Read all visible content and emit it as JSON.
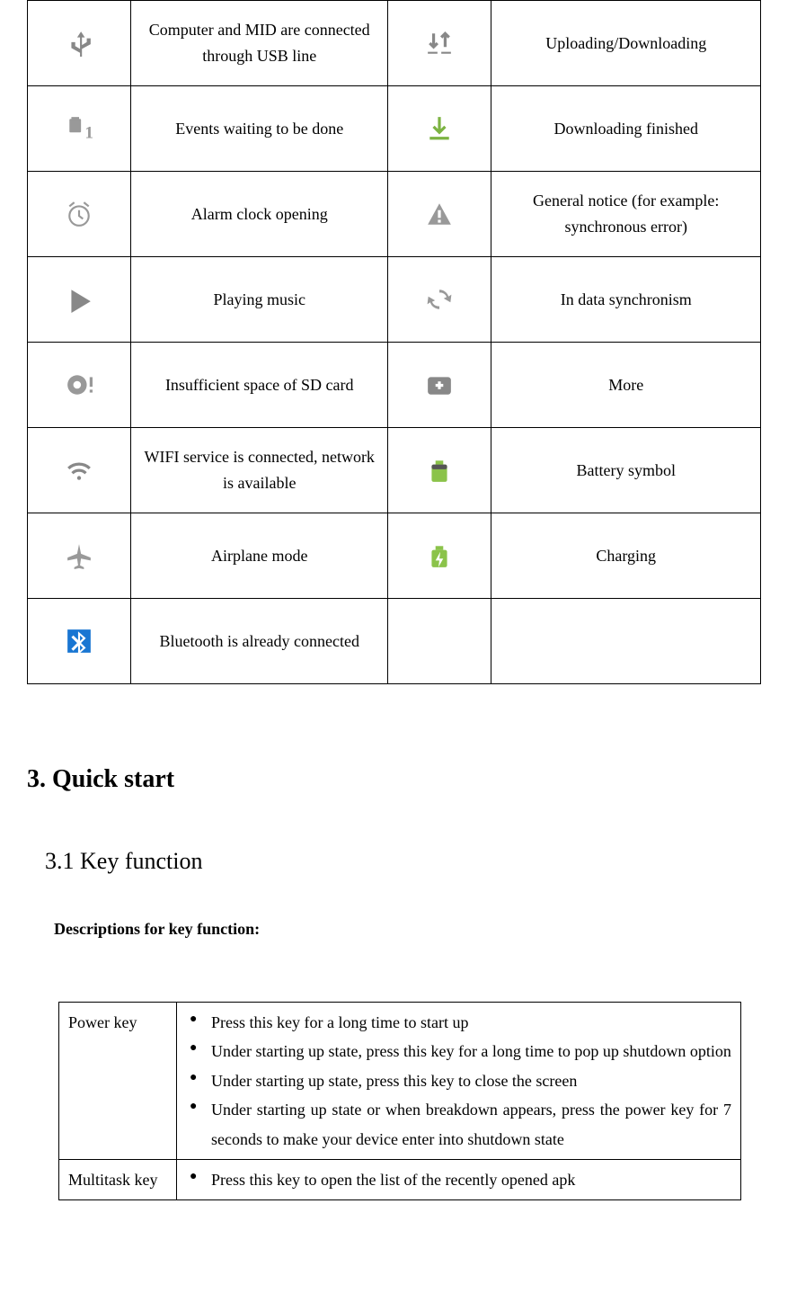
{
  "icon_table": {
    "rows": [
      {
        "leftIcon": "usb-icon",
        "leftDesc": "Computer and MID are connected through USB line",
        "rightIcon": "upload-download-icon",
        "rightDesc": "Uploading/Downloading"
      },
      {
        "leftIcon": "events-icon",
        "leftDesc": "Events waiting to be done",
        "rightIcon": "download-finished-icon",
        "rightDesc": "Downloading finished"
      },
      {
        "leftIcon": "alarm-icon",
        "leftDesc": "Alarm clock opening",
        "rightIcon": "warning-icon",
        "rightDesc": "General notice (for example: synchronous error)"
      },
      {
        "leftIcon": "play-icon",
        "leftDesc": "Playing music",
        "rightIcon": "sync-icon",
        "rightDesc": "In data synchronism"
      },
      {
        "leftIcon": "sd-insufficient-icon",
        "leftDesc": "Insufficient space of SD card",
        "rightIcon": "more-icon",
        "rightDesc": "More"
      },
      {
        "leftIcon": "wifi-icon",
        "leftDesc": "WIFI service is connected, network is available",
        "rightIcon": "battery-icon",
        "rightDesc": "Battery symbol"
      },
      {
        "leftIcon": "airplane-icon",
        "leftDesc": "Airplane mode",
        "rightIcon": "charging-icon",
        "rightDesc": "Charging"
      },
      {
        "leftIcon": "bluetooth-icon",
        "leftDesc": "Bluetooth is already connected",
        "rightIcon": "",
        "rightDesc": ""
      }
    ]
  },
  "section3": {
    "title": "3. Quick start",
    "subsection": "3.1 Key function",
    "descLine": "Descriptions for key function:"
  },
  "key_table": {
    "rows": [
      {
        "name": "Power key",
        "bullets": [
          "Press this key for a long time to start up",
          "Under starting up state, press this key for a long time to pop up shutdown option",
          "Under starting up state, press this key to close the screen",
          "Under starting up state or when breakdown appears, press the power key for 7 seconds to make your device enter into shutdown state"
        ]
      },
      {
        "name": "Multitask key",
        "bullets": [
          "Press this key to open the list of the recently opened apk"
        ]
      }
    ]
  }
}
